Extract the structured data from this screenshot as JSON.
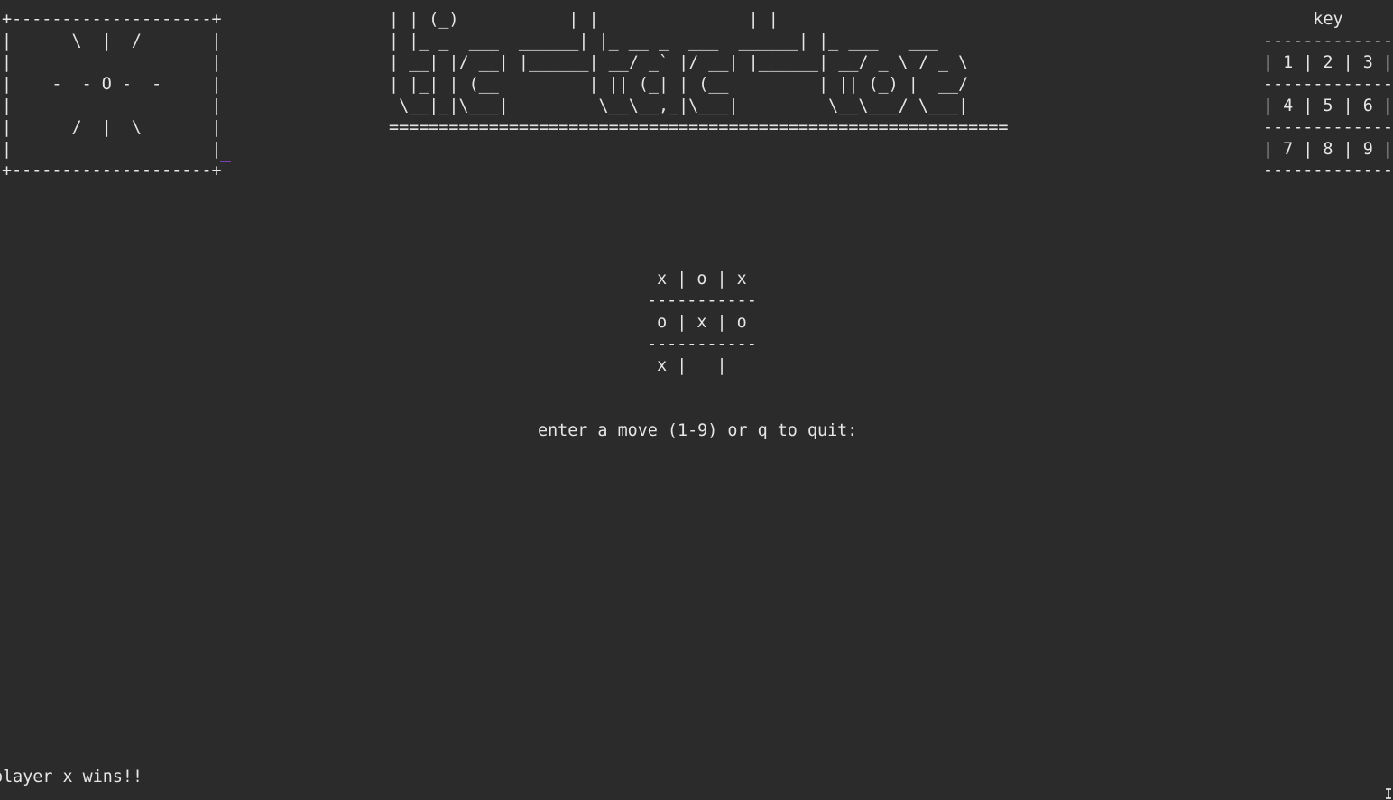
{
  "sun_box": {
    "art": "+--------------------+\n|      \\  |  /       |\n|                    |\n|    -  - O -  -     |\n|                    |\n|      /  |  \\       |\n|                    |\n+--------------------+"
  },
  "title_banner": {
    "art": "| | (_)           | |               | |\n| |_ _  ___  ______| |_ __ _  ___  ______| |_ ___   ___\n| __| |/ __| |______| __/ _` |/ __| |______| __/ _ \\ / _ \\\n| |_| | (__         | || (_| | (__         | || (_) |  __/\n \\__|_|\\___|         \\__\\__,_|\\___|         \\__\\___/ \\___|\n=============================================================="
  },
  "key": {
    "header": "key",
    "grid": "-------------\n| 1 | 2 | 3 |\n-------------\n| 4 | 5 | 6 |\n-------------\n| 7 | 8 | 9 |\n-------------"
  },
  "board": {
    "art": " x | o | x\n-----------\n o | x | o\n-----------\n x |   |"
  },
  "prompt": {
    "text": "enter a move (1-9) or q to quit:"
  },
  "status": {
    "text": "player x wins!!"
  }
}
